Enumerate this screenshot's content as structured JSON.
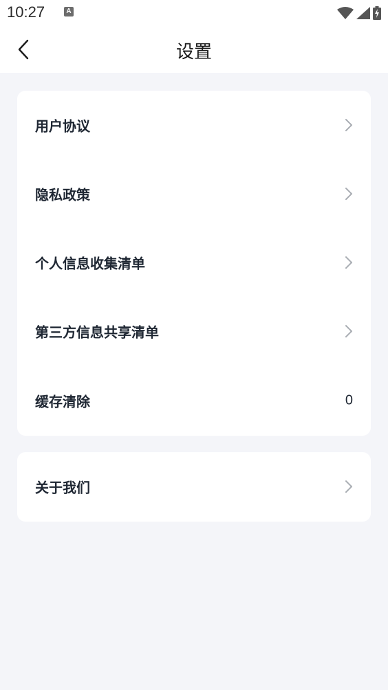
{
  "status_bar": {
    "time": "10:27",
    "notification_glyph": "A",
    "icons": [
      "wifi-icon",
      "signal-icon",
      "battery-charging-icon"
    ]
  },
  "header": {
    "title": "设置",
    "back_icon": "chevron-left-icon"
  },
  "settings": {
    "group1": [
      {
        "label": "用户协议",
        "icon": "chevron-right-icon"
      },
      {
        "label": "隐私政策",
        "icon": "chevron-right-icon"
      },
      {
        "label": "个人信息收集清单",
        "icon": "chevron-right-icon"
      },
      {
        "label": "第三方信息共享清单",
        "icon": "chevron-right-icon"
      },
      {
        "label": "缓存清除",
        "value": "0"
      }
    ],
    "group2": [
      {
        "label": "关于我们",
        "icon": "chevron-right-icon"
      }
    ]
  },
  "colors": {
    "background": "#f4f5f9",
    "card": "#ffffff",
    "text": "#1f2733",
    "chevron": "#a9adb3"
  }
}
